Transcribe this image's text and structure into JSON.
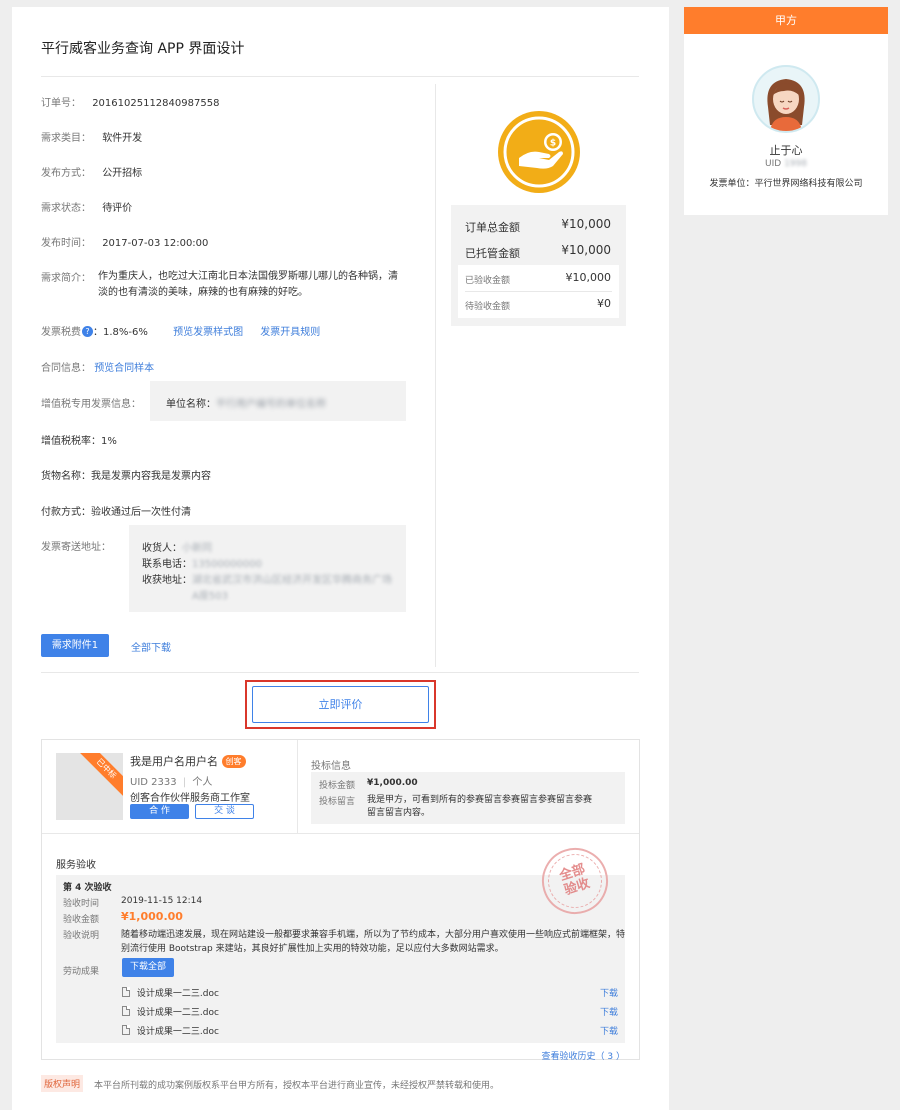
{
  "header": {
    "title": "平行威客业务查询 APP 界面设计"
  },
  "order": {
    "rows": [
      {
        "label": "订单号：",
        "value": "20161025112840987558"
      },
      {
        "label": "需求类目：",
        "value": "软件开发"
      },
      {
        "label": "发布方式：",
        "value": "公开招标"
      },
      {
        "label": "需求状态：",
        "value": "待评价"
      },
      {
        "label": "发布时间：",
        "value": "2017-07-03 12:00:00"
      }
    ],
    "intro_label": "需求简介：",
    "intro_line1": "作为重庆人，也吃过大江南北日本法国俄罗斯哪儿哪儿的各种锅，清",
    "intro_line2": "淡的也有清淡的美味，麻辣的也有麻辣的好吃。",
    "tax_label": "发票税费",
    "tax_value": "：1.8%-6%",
    "tax_link1": "预览发票样式图",
    "tax_link2": "发票开具规则",
    "contract_label": "合同信息：",
    "contract_link": "预览合同样本",
    "vat_invoice_label": "增值税专用发票信息：",
    "unit_name_label": "单位名称：",
    "unit_name_value": "平行用户编号的单位名称",
    "vat_rate": "增值税税率：1%",
    "goods": "货物名称：我是发票内容我是发票内容",
    "payment": "付款方式：验收通过后一次性付清",
    "address_label": "发票寄送地址：",
    "receiver_label": "收货人：",
    "receiver_value": "小新同",
    "phone_label": "联系电话：",
    "phone_value": "13500000000",
    "addr_label": "收获地址：",
    "addr_value1": "湖北省武汉市洪山区经济开发区华腾商务广场",
    "addr_value2": "A座503",
    "attach_button": "需求附件1",
    "download_all": "全部下载"
  },
  "amounts": {
    "total_label": "订单总金额",
    "total_value": "¥10,000",
    "escrow_label": "已托管金额",
    "escrow_value": "¥10,000",
    "received_label": "已验收金额",
    "received_value": "¥10,000",
    "pending_label": "待验收金额",
    "pending_value": "¥0"
  },
  "review_button": "立即评价",
  "bidder": {
    "ribbon": "已中标",
    "name": "我是用户名用户名",
    "badge": "创客",
    "uid": "UID 2333",
    "type": "个人",
    "company": "创客合作伙伴服务商工作室",
    "cooperate_button": "合 作",
    "chat_button": "交 谈",
    "bid_title": "投标信息",
    "bid_amount_label": "投标金额",
    "bid_amount_value": "¥1,000.00",
    "bid_message_label": "投标留言",
    "bid_message_line1": "我是甲方，可看到所有的参赛留言参赛留言参赛留言参赛",
    "bid_message_line2": "留言留言内容。"
  },
  "acceptance": {
    "title": "服务验收",
    "stamp_line1": "全部",
    "stamp_line2": "验收",
    "round": "第 4 次验收",
    "time_label": "验收时间",
    "time_value": "2019-11-15 12:14",
    "amount_label": "验收金额",
    "amount_value": "¥1,000.00",
    "desc_label": "验收说明",
    "desc_line1": "随着移动端迅速发展，现在网站建设一般都要求兼容手机端，所以为了节约成本，大部分用户喜欢使用一些响应式前端框架，特",
    "desc_line2": "别流行使用 Bootstrap 来建站，其良好扩展性加上实用的特效功能，足以应付大多数网站需求。",
    "results_label": "劳动成果",
    "download_all_button": "下载全部",
    "files": [
      {
        "name": "设计成果一二三.doc",
        "action": "下载"
      },
      {
        "name": "设计成果一二三.doc",
        "action": "下载"
      },
      {
        "name": "设计成果一二三.doc",
        "action": "下载"
      }
    ],
    "history_link": "查看验收历史（ 3 ）"
  },
  "copyright": {
    "tag": "版权声明",
    "text": "本平台所刊载的成功案例版权系平台甲方所有，授权本平台进行商业宣传，未经授权严禁转载和使用。"
  },
  "sidebar": {
    "header": "甲方",
    "user_name": "止于心",
    "uid_label": "UID",
    "uid_value": "1998",
    "invoice_unit": "发票单位：平行世界网络科技有限公司"
  },
  "colors": {
    "accent_orange": "#ff7d2c",
    "link_blue": "#3d7ddb",
    "button_blue": "#3f82e8",
    "highlight_red": "#d9372b",
    "coin_yellow": "#f2ad17"
  },
  "icons": {
    "coin_hand": "coin-hand-icon",
    "question": "question-icon",
    "file": "file-icon",
    "stamp": "acceptance-stamp"
  }
}
